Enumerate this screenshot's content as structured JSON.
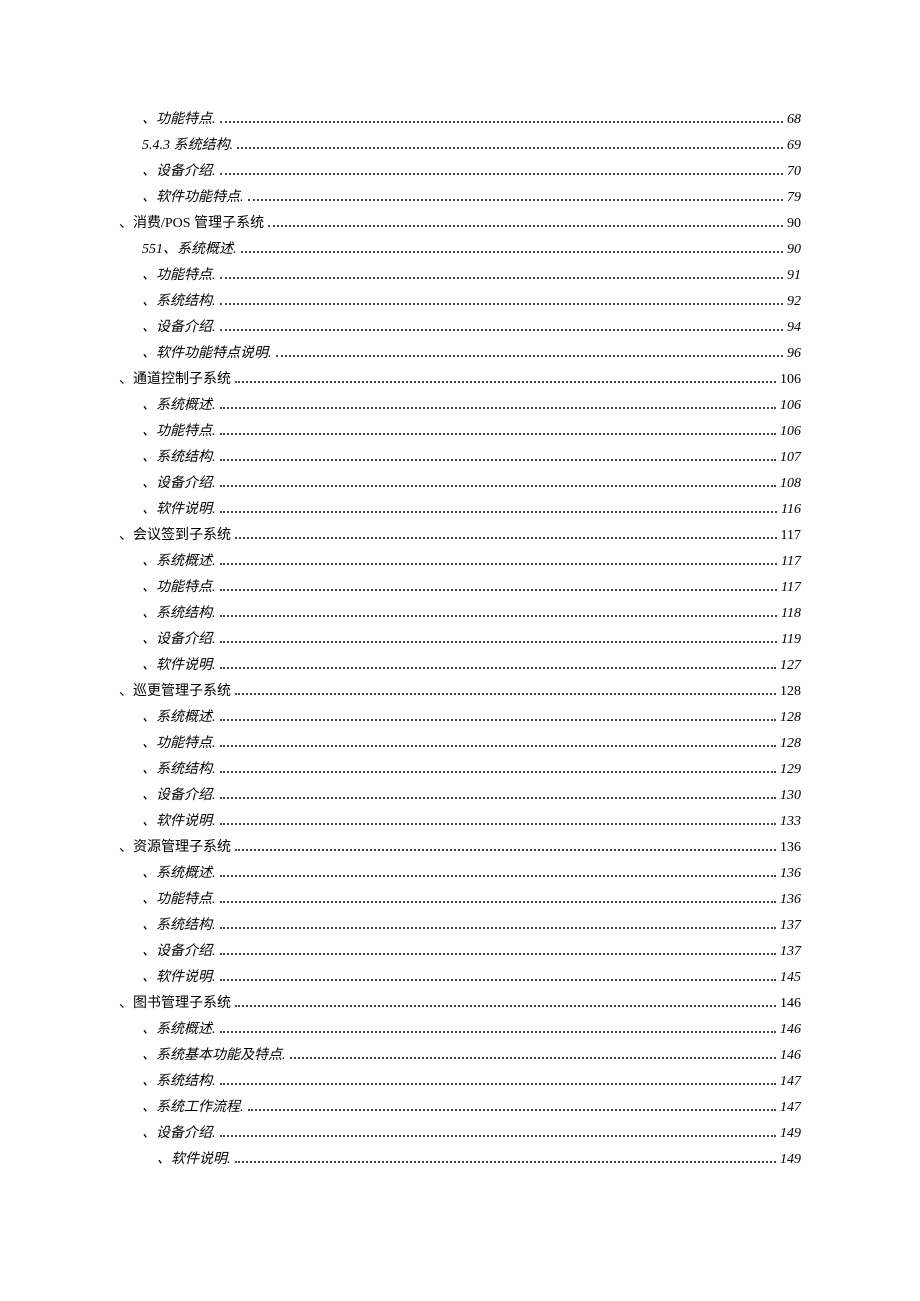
{
  "toc": [
    {
      "indent": 2,
      "italic": true,
      "prefix": "、",
      "label": "功能特点.",
      "page": "68"
    },
    {
      "indent": 2,
      "italic": true,
      "prefix": "",
      "label": "5.4.3 系统结构.",
      "page": "69"
    },
    {
      "indent": 2,
      "italic": true,
      "prefix": "、",
      "label": "设备介绍.",
      "page": "70"
    },
    {
      "indent": 2,
      "italic": true,
      "prefix": "、",
      "label": "软件功能特点.",
      "page": "79"
    },
    {
      "indent": 0,
      "italic": false,
      "prefix": "、",
      "label": "消费/POS 管理子系统",
      "page": "90"
    },
    {
      "indent": 2,
      "italic": true,
      "prefix": "",
      "label": "551、系统概述.",
      "page": "90"
    },
    {
      "indent": 2,
      "italic": true,
      "prefix": "、",
      "label": "功能特点.",
      "page": "91"
    },
    {
      "indent": 2,
      "italic": true,
      "prefix": "、",
      "label": "系统结构.",
      "page": "92"
    },
    {
      "indent": 2,
      "italic": true,
      "prefix": "、",
      "label": "设备介绍.",
      "page": "94"
    },
    {
      "indent": 2,
      "italic": true,
      "prefix": "、",
      "label": "软件功能特点说明.",
      "page": "96"
    },
    {
      "indent": 0,
      "italic": false,
      "prefix": "、",
      "label": "通道控制子系统",
      "page": "106"
    },
    {
      "indent": 2,
      "italic": true,
      "prefix": "、",
      "label": "系统概述.",
      "page": "106"
    },
    {
      "indent": 2,
      "italic": true,
      "prefix": "、",
      "label": "功能特点.",
      "page": "106"
    },
    {
      "indent": 2,
      "italic": true,
      "prefix": "、",
      "label": "系统结构.",
      "page": "107"
    },
    {
      "indent": 2,
      "italic": true,
      "prefix": "、",
      "label": "设备介绍.",
      "page": "108"
    },
    {
      "indent": 2,
      "italic": true,
      "prefix": "、",
      "label": "软件说明.",
      "page": "116"
    },
    {
      "indent": 0,
      "italic": false,
      "prefix": "、",
      "label": "会议签到子系统",
      "page": "117"
    },
    {
      "indent": 2,
      "italic": true,
      "prefix": "、",
      "label": "系统概述.",
      "page": "117"
    },
    {
      "indent": 2,
      "italic": true,
      "prefix": "、",
      "label": "功能特点.",
      "page": "117"
    },
    {
      "indent": 2,
      "italic": true,
      "prefix": "、",
      "label": "系统结构.",
      "page": "118"
    },
    {
      "indent": 2,
      "italic": true,
      "prefix": "、",
      "label": "设备介绍.",
      "page": "119"
    },
    {
      "indent": 2,
      "italic": true,
      "prefix": "、",
      "label": "软件说明.",
      "page": "127"
    },
    {
      "indent": 0,
      "italic": false,
      "prefix": "、",
      "label": "巡更管理子系统",
      "page": "128"
    },
    {
      "indent": 2,
      "italic": true,
      "prefix": "、",
      "label": "系统概述.",
      "page": "128"
    },
    {
      "indent": 2,
      "italic": true,
      "prefix": "、",
      "label": "功能特点.",
      "page": "128"
    },
    {
      "indent": 2,
      "italic": true,
      "prefix": "、",
      "label": "系统结构.",
      "page": "129"
    },
    {
      "indent": 2,
      "italic": true,
      "prefix": "、",
      "label": "设备介绍.",
      "page": "130"
    },
    {
      "indent": 2,
      "italic": true,
      "prefix": "、",
      "label": "软件说明.",
      "page": "133"
    },
    {
      "indent": 0,
      "italic": false,
      "prefix": "、",
      "label": "资源管理子系统",
      "page": "136"
    },
    {
      "indent": 2,
      "italic": true,
      "prefix": "、",
      "label": "系统概述.",
      "page": "136"
    },
    {
      "indent": 2,
      "italic": true,
      "prefix": "、",
      "label": "功能特点.",
      "page": "136"
    },
    {
      "indent": 2,
      "italic": true,
      "prefix": "、",
      "label": "系统结构.",
      "page": "137"
    },
    {
      "indent": 2,
      "italic": true,
      "prefix": "、",
      "label": "设备介绍.",
      "page": "137"
    },
    {
      "indent": 2,
      "italic": true,
      "prefix": "、",
      "label": "软件说明.",
      "page": "145"
    },
    {
      "indent": 0,
      "italic": false,
      "prefix": "、",
      "label": "图书管理子系统",
      "page": "146"
    },
    {
      "indent": 2,
      "italic": true,
      "prefix": "、",
      "label": "系统概述.",
      "page": "146"
    },
    {
      "indent": 2,
      "italic": true,
      "prefix": "、",
      "label": "系统基本功能及特点.",
      "page": "146"
    },
    {
      "indent": 2,
      "italic": true,
      "prefix": "、",
      "label": "系统结构.",
      "page": "147"
    },
    {
      "indent": 2,
      "italic": true,
      "prefix": "、",
      "label": "系统工作流程.",
      "page": "147"
    },
    {
      "indent": 2,
      "italic": true,
      "prefix": "、",
      "label": "设备介绍.",
      "page": "149"
    },
    {
      "indent": 3,
      "italic": true,
      "prefix": "、",
      "label": "软件说明.",
      "page": "149"
    }
  ]
}
